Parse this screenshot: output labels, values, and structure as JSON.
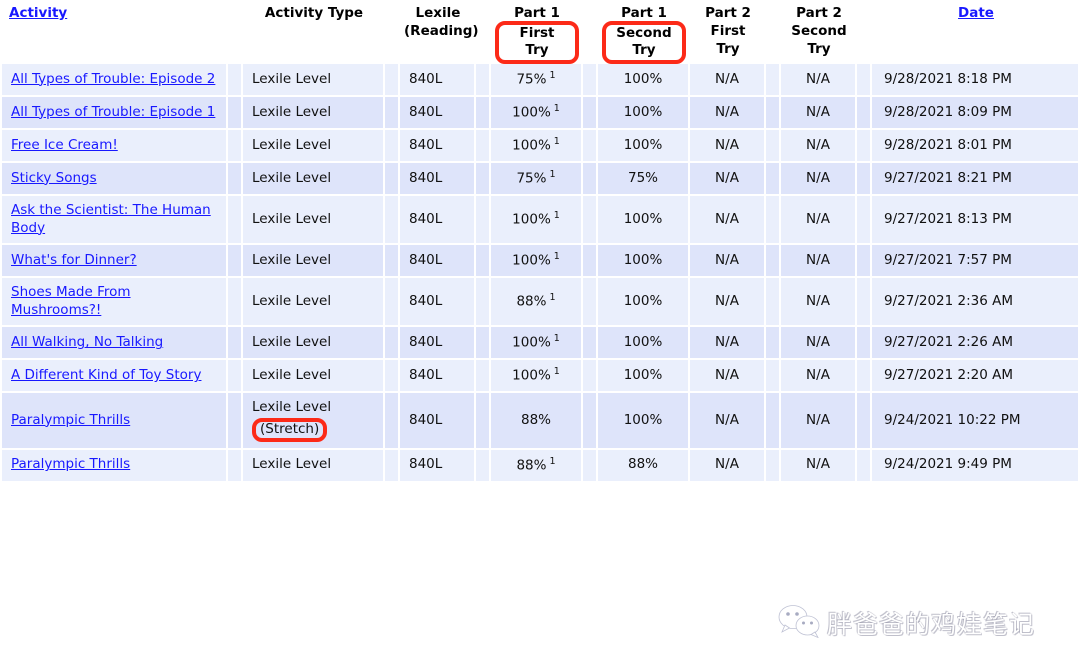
{
  "table": {
    "headers": {
      "activity": "Activity",
      "activity_type": "Activity Type",
      "lexile_line1": "Lexile",
      "lexile_line2": "(Reading)",
      "p1_line1": "Part 1",
      "p1_first_try": "First Try",
      "p1_line1b": "Part 1",
      "p1_second_try": "Second Try",
      "p2first_line1": "Part 2",
      "p2first_line2": "First",
      "p2first_line3": "Try",
      "p2second_line1": "Part 2",
      "p2second_line2": "Second",
      "p2second_line3": "Try",
      "date": "Date"
    },
    "highlight_color": "#fc2a18",
    "link_color": "#1818ff",
    "row_colors": [
      "#eaeffc",
      "#dee4fa"
    ],
    "rows": [
      {
        "activity": "All Types of Trouble: Episode 2",
        "type": "Lexile Level",
        "type_note": "",
        "lexile": "840L",
        "p1_first": "75%",
        "p1_first_sup": "1",
        "p1_second": "100%",
        "p2_first": "N/A",
        "p2_second": "N/A",
        "date": "9/28/2021  8:18 PM"
      },
      {
        "activity": "All Types of Trouble: Episode 1",
        "type": "Lexile Level",
        "type_note": "",
        "lexile": "840L",
        "p1_first": "100%",
        "p1_first_sup": "1",
        "p1_second": "100%",
        "p2_first": "N/A",
        "p2_second": "N/A",
        "date": "9/28/2021  8:09 PM"
      },
      {
        "activity": "Free Ice Cream!",
        "type": "Lexile Level",
        "type_note": "",
        "lexile": "840L",
        "p1_first": "100%",
        "p1_first_sup": "1",
        "p1_second": "100%",
        "p2_first": "N/A",
        "p2_second": "N/A",
        "date": "9/28/2021  8:01 PM"
      },
      {
        "activity": "Sticky Songs",
        "type": "Lexile Level",
        "type_note": "",
        "lexile": "840L",
        "p1_first": "75%",
        "p1_first_sup": "1",
        "p1_second": "75%",
        "p2_first": "N/A",
        "p2_second": "N/A",
        "date": "9/27/2021  8:21 PM"
      },
      {
        "activity": "Ask the Scientist: The Human Body",
        "type": "Lexile Level",
        "type_note": "",
        "lexile": "840L",
        "p1_first": "100%",
        "p1_first_sup": "1",
        "p1_second": "100%",
        "p2_first": "N/A",
        "p2_second": "N/A",
        "date": "9/27/2021  8:13 PM"
      },
      {
        "activity": "What's for Dinner?",
        "type": "Lexile Level",
        "type_note": "",
        "lexile": "840L",
        "p1_first": "100%",
        "p1_first_sup": "1",
        "p1_second": "100%",
        "p2_first": "N/A",
        "p2_second": "N/A",
        "date": "9/27/2021  7:57 PM"
      },
      {
        "activity": "Shoes Made From Mushrooms?!",
        "type": "Lexile Level",
        "type_note": "",
        "lexile": "840L",
        "p1_first": "88%",
        "p1_first_sup": "1",
        "p1_second": "100%",
        "p2_first": "N/A",
        "p2_second": "N/A",
        "date": "9/27/2021  2:36 AM"
      },
      {
        "activity": "All Walking, No Talking",
        "type": "Lexile Level",
        "type_note": "",
        "lexile": "840L",
        "p1_first": "100%",
        "p1_first_sup": "1",
        "p1_second": "100%",
        "p2_first": "N/A",
        "p2_second": "N/A",
        "date": "9/27/2021  2:26 AM"
      },
      {
        "activity": "A Different Kind of Toy Story",
        "type": "Lexile Level",
        "type_note": "",
        "lexile": "840L",
        "p1_first": "100%",
        "p1_first_sup": "1",
        "p1_second": "100%",
        "p2_first": "N/A",
        "p2_second": "N/A",
        "date": "9/27/2021  2:20 AM"
      },
      {
        "activity": "Paralympic Thrills",
        "type": "Lexile Level",
        "type_note": "(Stretch)",
        "lexile": "840L",
        "p1_first": "88%",
        "p1_first_sup": "",
        "p1_second": "100%",
        "p2_first": "N/A",
        "p2_second": "N/A",
        "date": "9/24/2021 10:22 PM"
      },
      {
        "activity": "Paralympic Thrills",
        "type": "Lexile Level",
        "type_note": "",
        "lexile": "840L",
        "p1_first": "88%",
        "p1_first_sup": "1",
        "p1_second": "88%",
        "p2_first": "N/A",
        "p2_second": "N/A",
        "date": "9/24/2021  9:49 PM"
      }
    ]
  },
  "watermark": {
    "text": "胖爸爸的鸡娃笔记",
    "icon": "wechat-icon"
  }
}
